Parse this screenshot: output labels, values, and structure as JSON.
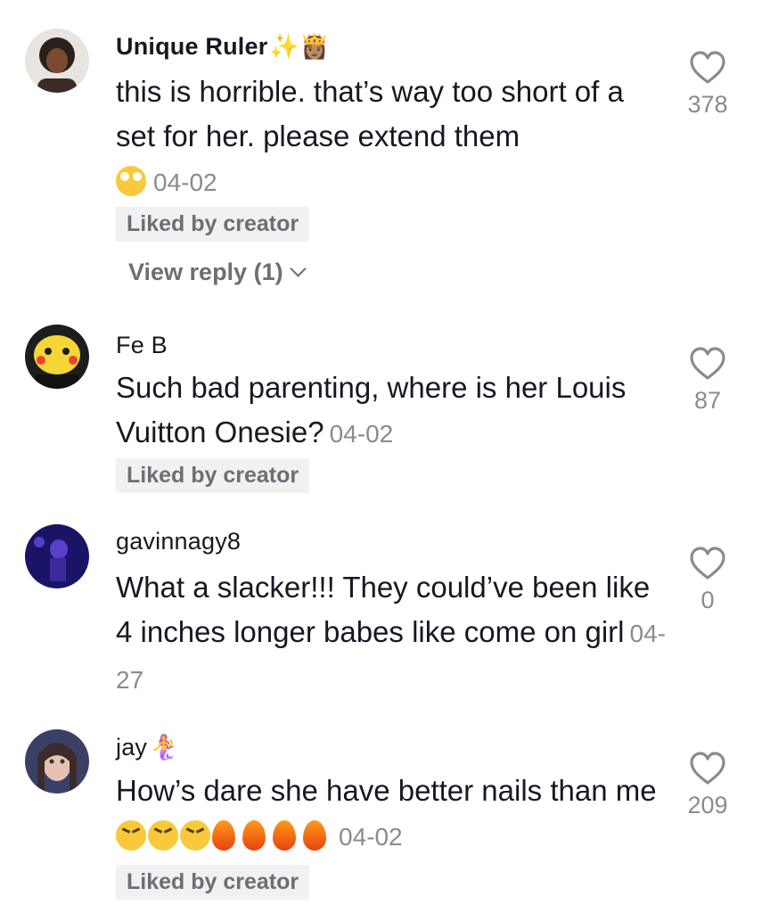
{
  "colors": {
    "text": "#161823",
    "muted": "#8a8b91",
    "liked_bg": "#f1f1f2"
  },
  "comments": [
    {
      "username": "Unique Ruler",
      "username_emoji": "✨👸🏽",
      "text": "this is horrible. that’s way too short of a set for her. please extend them",
      "text_emoji": "🙄",
      "date": "04-02",
      "liked_label": "Liked by creator",
      "view_reply": "View reply (1)",
      "likes": "378",
      "like_icon": "heart-outline-icon",
      "avatar_icon": "user-avatar"
    },
    {
      "username": "Fe B",
      "text": "Such bad parenting, where is her Louis Vuitton Onesie?",
      "date": "04-02",
      "liked_label": "Liked by creator",
      "likes": "87",
      "like_icon": "heart-outline-icon",
      "avatar_icon": "pikachu-avatar"
    },
    {
      "username": "gavinnagy8",
      "text": "What a slacker!!! They could’ve been like 4 inches longer babes like come on girl",
      "date": "04-27",
      "likes": "0",
      "like_icon": "heart-outline-icon",
      "avatar_icon": "user-avatar"
    },
    {
      "username": "jay",
      "username_emoji": "🧜‍♀️",
      "text": "How’s dare she have better nails than me",
      "text_emoji": "😫😫😫🔥🔥🔥🔥",
      "date": "04-02",
      "liked_label": "Liked by creator",
      "likes": "209",
      "like_icon": "heart-outline-icon",
      "avatar_icon": "user-avatar"
    }
  ]
}
